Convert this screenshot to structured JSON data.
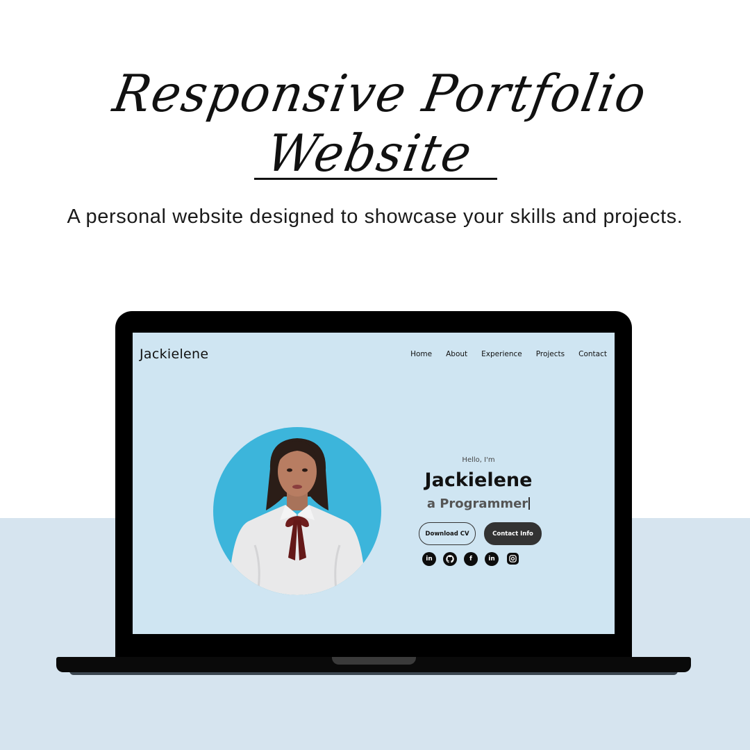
{
  "poster": {
    "script_title": "Responsive Portfolio Website",
    "subtitle": "A personal website designed to showcase your skills and projects."
  },
  "site": {
    "logo": "Jackielene",
    "nav": [
      "Home",
      "About",
      "Experience",
      "Projects",
      "Contact"
    ],
    "hero": {
      "greeting": "Hello, I'm",
      "name": "Jackielene",
      "role": "a Programmer"
    },
    "buttons": {
      "download_cv": "Download CV",
      "contact_info": "Contact Info"
    },
    "socials": [
      "linkedin-icon",
      "github-icon",
      "facebook-icon",
      "linkedin-icon",
      "instagram-icon"
    ]
  },
  "colors": {
    "page_bg": "#ffffff",
    "bottom_band": "#d6e4ef",
    "screen_bg": "#cfe5f2",
    "photo_circle": "#3cb5db",
    "button_dark": "#333333"
  }
}
